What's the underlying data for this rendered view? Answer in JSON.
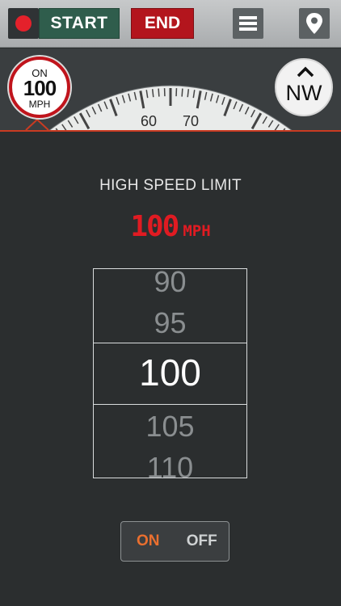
{
  "toolbar": {
    "start_label": "START",
    "end_label": "END",
    "menu_icon": "menu-icon",
    "location_icon": "map-pin-icon"
  },
  "limit_badge": {
    "status": "ON",
    "value": "100",
    "unit": "MPH"
  },
  "gauge": {
    "labels": [
      "60",
      "70"
    ]
  },
  "compass": {
    "direction": "NW",
    "icon": "chevron-up-icon"
  },
  "panel": {
    "title": "HIGH SPEED LIMIT",
    "readout_value": "100",
    "readout_unit": "MPH"
  },
  "picker": {
    "options": [
      "90",
      "95",
      "100",
      "105",
      "110"
    ],
    "selected": "100"
  },
  "toggle": {
    "on_label": "ON",
    "off_label": "OFF",
    "state": "ON"
  },
  "colors": {
    "accent_red": "#e01b22",
    "start_green": "#2f5d4c",
    "on_orange": "#ea6f2f"
  }
}
